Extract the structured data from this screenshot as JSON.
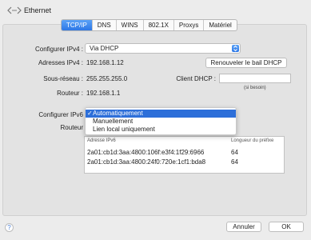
{
  "window": {
    "title": "Ethernet"
  },
  "tabs": [
    {
      "label": "TCP/IP"
    },
    {
      "label": "DNS"
    },
    {
      "label": "WINS"
    },
    {
      "label": "802.1X"
    },
    {
      "label": "Proxys"
    },
    {
      "label": "Matériel"
    }
  ],
  "ipv4": {
    "configure_label": "Configurer IPv4 :",
    "configure_value": "Via DHCP",
    "address_label": "Adresses IPv4 :",
    "address_value": "192.168.1.12",
    "subnet_label": "Sous-réseau :",
    "subnet_value": "255.255.255.0",
    "router_label": "Routeur :",
    "router_value": "192.168.1.1",
    "renew_button": "Renouveler le bail DHCP",
    "client_label": "Client DHCP :",
    "client_hint": "(si besoin)"
  },
  "ipv6": {
    "configure_label": "Configurer IPv6",
    "router_label": "Routeur",
    "options": [
      {
        "label": "Automatiquement",
        "check": "✓"
      },
      {
        "label": "Manuellement"
      },
      {
        "label": "Lien local uniquement"
      }
    ]
  },
  "table": {
    "col_address": "Adresse IPv6",
    "col_prefix": "Longueur du préfixe",
    "rows": [
      {
        "address": "2a01:cb1d:3aa:4800:106f:e3f4:1f29:6966",
        "prefix": "64"
      },
      {
        "address": "2a01:cb1d:3aa:4800:24f0:720e:1cf1:bda8",
        "prefix": "64"
      }
    ]
  },
  "footer": {
    "help": "?",
    "cancel": "Annuler",
    "ok": "OK"
  }
}
